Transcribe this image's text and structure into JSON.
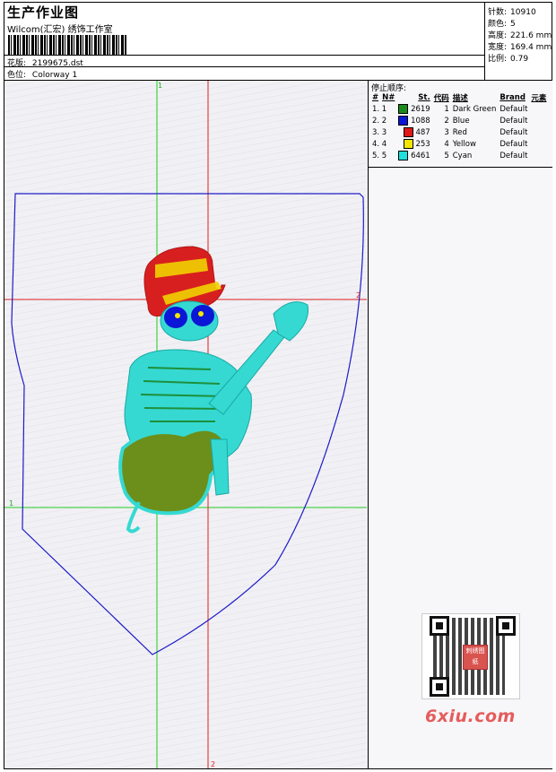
{
  "header": {
    "title": "生产作业图",
    "company": "Wilcom(汇宏) 绣饰工作室",
    "design_label": "花版:",
    "design_value": "2199675.dst",
    "colorway_label": "色位:",
    "colorway_value": "Colorway 1"
  },
  "stats": {
    "stitches_label": "针数:",
    "stitches_value": "10910",
    "colors_label": "颜色:",
    "colors_value": "5",
    "height_label": "高度:",
    "height_value": "221.6 mm",
    "width_label": "宽度:",
    "width_value": "169.4 mm",
    "scale_label": "比例:",
    "scale_value": "0.79"
  },
  "stop_sequence": {
    "title": "停止顺序:",
    "headers": {
      "hash": "#",
      "no": "N#",
      "stitches": "St.",
      "code": "代码",
      "desc": "描述",
      "brand": "Brand",
      "element": "元素"
    },
    "rows": [
      {
        "index": "1. 1",
        "color": "#1a8a1a",
        "stitches": "2619",
        "code": "1",
        "desc": "Dark Green",
        "brand": "Default"
      },
      {
        "index": "2. 2",
        "color": "#0b16d6",
        "stitches": "1088",
        "code": "2",
        "desc": "Blue",
        "brand": "Default"
      },
      {
        "index": "3. 3",
        "color": "#e01818",
        "stitches": "487",
        "code": "3",
        "desc": "Red",
        "brand": "Default"
      },
      {
        "index": "4. 4",
        "color": "#f2e600",
        "stitches": "253",
        "code": "4",
        "desc": "Yellow",
        "brand": "Default"
      },
      {
        "index": "5. 5",
        "color": "#1fe0dc",
        "stitches": "6461",
        "code": "5",
        "desc": "Cyan",
        "brand": "Default"
      }
    ]
  },
  "axes": {
    "v1": "1",
    "v2": "2",
    "h1": "1",
    "h2": "2"
  },
  "watermark": "6xiu.com",
  "qr_stamp": "刺绣图纸"
}
